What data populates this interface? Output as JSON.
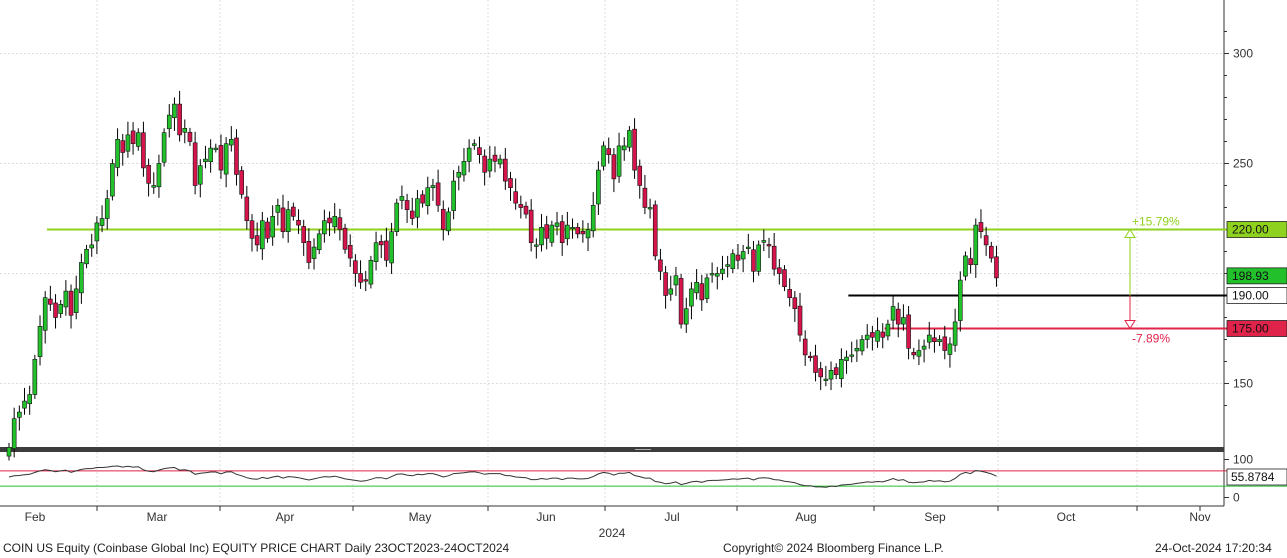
{
  "chart_data": {
    "type": "candlestick",
    "ticker": "COIN US Equity",
    "year_label": "2024",
    "months": [
      "Feb",
      "Mar",
      "Apr",
      "May",
      "Jun",
      "Jul",
      "Aug",
      "Sep",
      "Oct",
      "Nov"
    ],
    "y_ticks": [
      150,
      200,
      250,
      300
    ],
    "ylim": [
      120,
      320
    ],
    "last_price": 198.93,
    "levels": [
      {
        "label": "220.00",
        "value": 220.0,
        "color": "#8fd11f",
        "start_day": 0
      },
      {
        "label": "190.00",
        "value": 190.0,
        "color": "#000000",
        "start_day": 155
      },
      {
        "label": "175.00",
        "value": 175.0,
        "color": "#e0234a",
        "start_day": 162
      }
    ],
    "last_price_label": "198.93",
    "annotations": {
      "up_pct": "+15.79%",
      "down_pct": "-7.89%"
    },
    "closes": [
      121,
      134,
      137,
      142,
      145,
      161,
      176,
      189,
      186,
      180,
      186,
      192,
      181,
      193,
      205,
      211,
      213,
      223,
      225,
      234,
      250,
      261,
      255,
      263,
      259,
      264,
      248,
      241,
      240,
      250,
      264,
      272,
      277,
      263,
      266,
      260,
      240,
      249,
      252,
      257,
      257,
      247,
      259,
      261,
      245,
      236,
      224,
      216,
      213,
      224,
      216,
      226,
      231,
      219,
      229,
      226,
      222,
      214,
      205,
      212,
      218,
      224,
      223,
      226,
      220,
      211,
      207,
      200,
      196,
      197,
      206,
      214,
      213,
      206,
      219,
      232,
      235,
      229,
      225,
      234,
      232,
      239,
      240,
      231,
      220,
      228,
      242,
      246,
      251,
      257,
      259,
      254,
      246,
      252,
      251,
      252,
      242,
      239,
      232,
      230,
      227,
      214,
      213,
      221,
      216,
      222,
      223,
      214,
      222,
      221,
      218,
      218,
      220,
      231,
      247,
      258,
      254,
      243,
      258,
      258,
      265,
      247,
      240,
      230,
      230,
      208,
      201,
      190,
      193,
      199,
      177,
      184,
      193,
      196,
      188,
      198,
      200,
      200,
      202,
      204,
      209,
      206,
      210,
      212,
      201,
      213,
      215,
      213,
      202,
      200,
      194,
      189,
      184,
      172,
      163,
      162,
      155,
      153,
      152,
      156,
      154,
      161,
      162,
      163,
      166,
      170,
      172,
      171,
      174,
      171,
      177,
      185,
      177,
      180,
      166,
      163,
      165,
      167,
      172,
      169,
      170,
      165,
      168,
      178,
      197,
      208,
      204,
      222,
      219,
      213,
      207,
      198
    ],
    "rsi": {
      "ylim": [
        0,
        100
      ],
      "ticks": [
        100,
        0
      ],
      "upper_band": 70,
      "lower_band": 30,
      "last_value": "55.8784",
      "values": [
        54,
        57,
        58,
        60,
        61,
        66,
        70,
        73,
        71,
        68,
        70,
        72,
        66,
        70,
        74,
        76,
        76,
        79,
        79,
        80,
        82,
        83,
        80,
        82,
        80,
        81,
        73,
        69,
        68,
        72,
        76,
        78,
        79,
        72,
        73,
        70,
        61,
        64,
        65,
        67,
        67,
        62,
        67,
        68,
        61,
        57,
        52,
        49,
        48,
        53,
        50,
        54,
        56,
        51,
        55,
        54,
        52,
        49,
        46,
        49,
        52,
        55,
        54,
        56,
        53,
        49,
        47,
        45,
        43,
        44,
        48,
        52,
        52,
        49,
        55,
        61,
        62,
        59,
        57,
        61,
        60,
        63,
        63,
        59,
        54,
        57,
        63,
        64,
        65,
        67,
        68,
        65,
        61,
        63,
        63,
        63,
        58,
        57,
        54,
        53,
        52,
        47,
        47,
        50,
        48,
        51,
        51,
        47,
        51,
        51,
        49,
        49,
        50,
        55,
        62,
        66,
        64,
        59,
        64,
        64,
        66,
        58,
        55,
        51,
        51,
        42,
        40,
        36,
        38,
        41,
        34,
        37,
        41,
        43,
        40,
        44,
        45,
        45,
        46,
        47,
        49,
        48,
        50,
        51,
        46,
        51,
        52,
        51,
        47,
        46,
        43,
        41,
        39,
        34,
        31,
        31,
        28,
        28,
        27,
        30,
        29,
        33,
        34,
        35,
        37,
        39,
        41,
        40,
        42,
        41,
        45,
        50,
        45,
        47,
        40,
        39,
        40,
        41,
        45,
        43,
        44,
        41,
        43,
        50,
        61,
        66,
        63,
        71,
        69,
        66,
        62,
        56
      ]
    },
    "grid": true
  },
  "footer": {
    "left": "COIN US Equity (Coinbase Global Inc) EQUITY PRICE CHART  Daily 23OCT2023-24OCT2024",
    "center": "Copyright© 2024 Bloomberg Finance L.P.",
    "right": "24-Oct-2024 17:20:34"
  },
  "colors": {
    "up": "#22c02b",
    "down": "#d4144b",
    "wick": "#000000"
  }
}
